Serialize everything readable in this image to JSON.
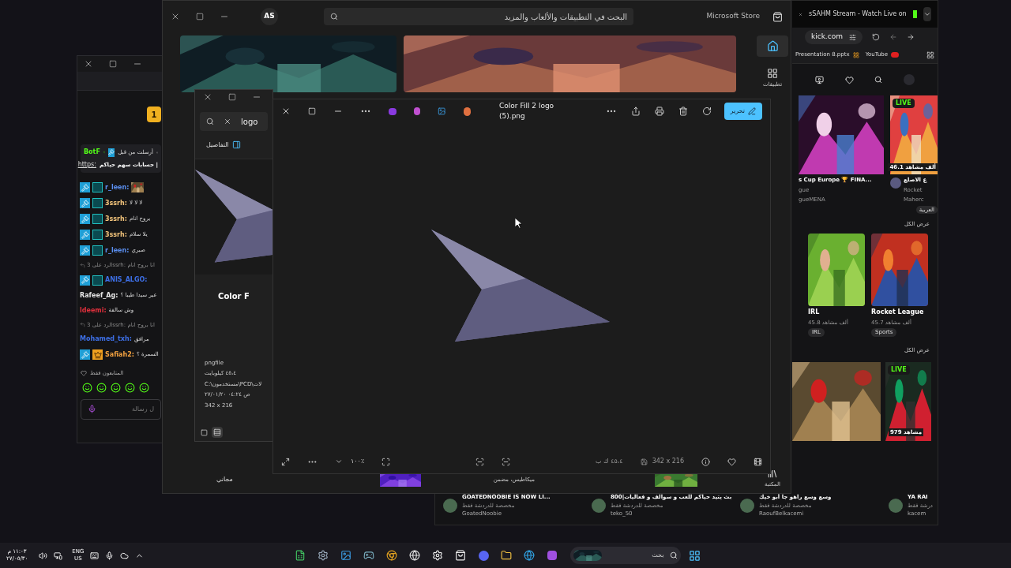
{
  "store": {
    "title": "Microsoft Store",
    "search": {
      "placeholder": "البحث في التطبيقات والألعاب والمزيد"
    },
    "avatar": "AS",
    "nav": [
      {
        "kind": "home",
        "selected": true
      },
      {
        "kind": "apps",
        "label": "تطبيقات",
        "selected": false
      },
      {
        "kind": "library",
        "label": "المكتبة",
        "selected": false
      }
    ],
    "price": "مجاني",
    "caption": "ميكاطيس، مضمن"
  },
  "chat": {
    "rank_badge": "1",
    "pinned": {
      "header": "أرسلت من قبل",
      "sender": "BotF",
      "text": "حسابات سهم حياكم |",
      "link": "https:"
    },
    "messages": [
      {
        "kind": "mod",
        "user": "r_leen:",
        "color": "#5b8ff0"
      },
      {
        "kind": "mod",
        "user": "3ssrh:",
        "text": "لا لا لا",
        "color": "#f0c27a"
      },
      {
        "kind": "mod",
        "user": "3ssrh:",
        "text": "يروح انام",
        "color": "#f0c27a"
      },
      {
        "kind": "mod",
        "user": "3ssrh:",
        "text": "يلا سلام",
        "color": "#f0c27a"
      },
      {
        "kind": "mod",
        "user": "r_leen:",
        "text": "صبري",
        "color": "#5b8ff0"
      },
      {
        "kind": "reply",
        "text": "الرد على 3ssrh: انا بروح انام"
      },
      {
        "kind": "mod",
        "user": "ANIS_ALGO:",
        "color": "#3d6fe6"
      },
      {
        "kind": "plain",
        "user": "Rafeef_Ag:",
        "text": "عير سيدا طيبا ؟",
        "color": "#e6e6e6"
      },
      {
        "kind": "plain",
        "user": "ldeemi:",
        "text": "وش سالفة",
        "color": "#e0303c"
      },
      {
        "kind": "reply",
        "text": "الرد على 3ssrh: انا بروح انام"
      },
      {
        "kind": "plain",
        "user": "Mohamed_txh:",
        "text": "مرافق",
        "color": "#3d6fe6"
      },
      {
        "kind": "vip",
        "user": "Safiah2:",
        "text": "السمرة ؟",
        "color": "#f0a040"
      }
    ],
    "followers_only": "المتابعون فقط",
    "input": {
      "placeholder": "ل رسالة"
    }
  },
  "explorer": {
    "search": "logo",
    "details_button": "التفاصيل",
    "file_name": "Color F",
    "info": [
      "pngfile",
      "٤٥،٤ كيلوبايت",
      "C:\\مستخدمون\\PCD\\لات",
      "ص ٠٤:٢٤ ٢٧/٠١/٢٠",
      "342 x 216"
    ],
    "view_modes": [
      {
        "kind": "tiles",
        "selected": false
      },
      {
        "kind": "list",
        "selected": true
      }
    ]
  },
  "viewer": {
    "file_name": "Color Fill 2 logo (5).png",
    "edit_button": "تحرير",
    "zoom": "١٠٠٪",
    "file_size": "٤٥،٤ ك ب",
    "dimensions": "342 x 216"
  },
  "browser": {
    "tab_title": "sSAHM Stream - Watch Live on",
    "url": "kick.com",
    "bookmarks": [
      "YouTube",
      "Presentation 8.pptx"
    ],
    "streams": [
      {
        "live_label": "LIVE",
        "viewers": "46.1 ألف مشاهد",
        "title": "ع الاصلع",
        "category": "Rocket",
        "channel": "Maherc",
        "tag": "العربية"
      },
      {
        "title": "s Cup Europe 🏆 FINA...",
        "category": "gue",
        "channel": "gueMENA"
      }
    ],
    "see_all": "عرض الكل",
    "categories": [
      {
        "name": "Rocket League",
        "viewers": "45.7 ألف مشاهد",
        "tag": "Sports"
      },
      {
        "name": "IRL",
        "viewers": "45.8 ألف مشاهد",
        "tag": "IRL"
      }
    ],
    "see_all_2": "عرض الكل",
    "streams_2": [
      {
        "live_label": "LIVE",
        "viewers": "979 مشاهد"
      }
    ],
    "bottom_row": [
      {
        "title": "YA RAI",
        "note": "درشة فقط",
        "channel": "kacem"
      },
      {
        "title": "وسع وسع راهو جا أبو خيك",
        "note": "مخصصة للدردشة فقط",
        "channel": "RaoufBelkacemi"
      },
      {
        "title": "بث يتيد حياكم للعب و سوالف و فعاليات|800",
        "note": "مخصصة للدردشة فقط",
        "channel": "teko_50"
      },
      {
        "title": "GOATEDNOOBIE IS NOW LI...",
        "note": "مخصصة للدردشة فقط",
        "channel": "GoatedNoobie"
      }
    ]
  },
  "taskbar": {
    "time": "١١:٠٣ م",
    "date": "٢٧/٠٥/٣٠",
    "language": "ENG",
    "layout": "US",
    "search": {
      "placeholder": "بحث"
    }
  }
}
